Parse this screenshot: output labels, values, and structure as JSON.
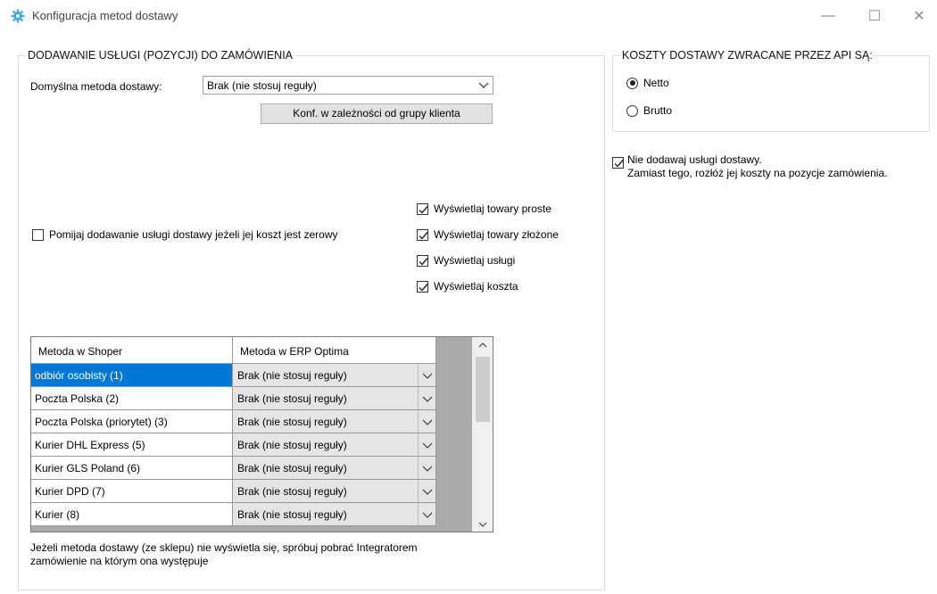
{
  "window": {
    "title": "Konfiguracja metod dostawy",
    "icon": "gear-icon",
    "controls": {
      "minimize": "—",
      "maximize": "☐",
      "close": "✕"
    }
  },
  "left_group": {
    "title": "DODAWANIE USŁUGI (POZYCJI) DO ZAMÓWIENIA",
    "default_method_label": "Domyślna metoda dostawy:",
    "default_method_value": "Brak (nie stosuj reguły)",
    "client_group_button": "Konf. w zależności od grupy klienta",
    "skip_zero_cost": {
      "label": "Pomijaj dodawanie usługi dostawy jeżeli jej koszt jest zerowy",
      "checked": false
    },
    "display_options": [
      {
        "label": "Wyświetlaj towary proste",
        "checked": true
      },
      {
        "label": "Wyświetlaj towary złożone",
        "checked": true
      },
      {
        "label": "Wyświetlaj usługi",
        "checked": true
      },
      {
        "label": "Wyświetlaj koszta",
        "checked": true
      }
    ],
    "grid": {
      "columns": [
        "Metoda w Shoper",
        "Metoda w ERP Optima"
      ],
      "rows": [
        {
          "shop": "odbiór osobisty (1)",
          "erp": "Brak (nie stosuj reguły)",
          "selected": true
        },
        {
          "shop": "Poczta Polska (2)",
          "erp": "Brak (nie stosuj reguły)",
          "selected": false
        },
        {
          "shop": "Poczta Polska (priorytet) (3)",
          "erp": "Brak (nie stosuj reguły)",
          "selected": false
        },
        {
          "shop": "Kurier DHL Express (5)",
          "erp": "Brak (nie stosuj reguły)",
          "selected": false
        },
        {
          "shop": "Kurier GLS Poland (6)",
          "erp": "Brak (nie stosuj reguły)",
          "selected": false
        },
        {
          "shop": "Kurier DPD (7)",
          "erp": "Brak (nie stosuj reguły)",
          "selected": false
        },
        {
          "shop": "Kurier (8)",
          "erp": "Brak (nie stosuj reguły)",
          "selected": false
        }
      ]
    },
    "note_line1": "Jeżeli metoda dostawy (ze sklepu) nie wyświetla się, spróbuj pobrać Integratorem",
    "note_line2": "zamówienie na którym ona występuje"
  },
  "right_group": {
    "title": "KOSZTY DOSTAWY ZWRACANE PRZEZ API SĄ:",
    "options": [
      {
        "label": "Netto",
        "selected": true
      },
      {
        "label": "Brutto",
        "selected": false
      }
    ]
  },
  "no_delivery_service": {
    "line1": "Nie dodawaj usługi dostawy.",
    "line2": "Zamiast tego, rozłóż jej koszty na pozycje zamówienia.",
    "checked": true
  },
  "colors": {
    "selection": "#0078d7",
    "icon": "#3fa9dc"
  }
}
